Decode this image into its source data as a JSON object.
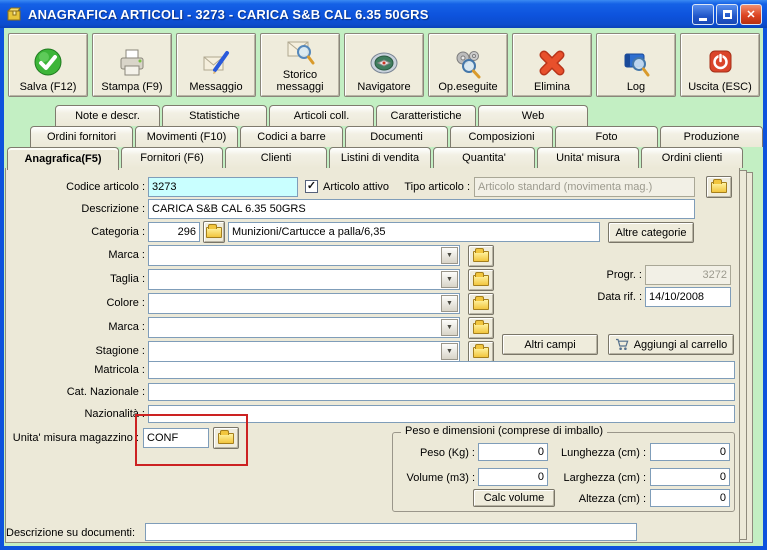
{
  "window": {
    "title": "ANAGRAFICA ARTICOLI - 3273 - CARICA S&B CAL 6.35 50GRS"
  },
  "toolbar": {
    "buttons": [
      {
        "label": "Salva (F12)",
        "icon": "save-check-icon"
      },
      {
        "label": "Stampa (F9)",
        "icon": "printer-icon"
      },
      {
        "label": "Messaggio",
        "icon": "message-pen-icon"
      },
      {
        "label": "Storico messaggi",
        "icon": "message-history-icon"
      },
      {
        "label": "Navigatore",
        "icon": "compass-icon"
      },
      {
        "label": "Op.eseguite",
        "icon": "gears-search-icon"
      },
      {
        "label": "Elimina",
        "icon": "red-x-icon"
      },
      {
        "label": "Log",
        "icon": "book-search-icon"
      },
      {
        "label": "Uscita (ESC)",
        "icon": "power-icon"
      }
    ]
  },
  "tabs": {
    "row1": [
      "Note e descr.",
      "Statistiche",
      "Articoli coll.",
      "Caratteristiche",
      "Web"
    ],
    "row2": [
      "Ordini fornitori",
      "Movimenti (F10)",
      "Codici a barre",
      "Documenti",
      "Composizioni",
      "Foto",
      "Produzione"
    ],
    "row3": [
      "Anagrafica(F5)",
      "Fornitori (F6)",
      "Clienti",
      "Listini di vendita",
      "Quantita'",
      "Unita' misura",
      "Ordini clienti"
    ],
    "active_tab": "Anagrafica(F5)"
  },
  "form": {
    "codice_articolo_label": "Codice articolo :",
    "codice_articolo_value": "3273",
    "articolo_attivo_label": "Articolo attivo",
    "articolo_attivo_checked": "✓",
    "tipo_articolo_label": "Tipo articolo :",
    "tipo_articolo_value": "Articolo standard (movimenta mag.)",
    "descrizione_label": "Descrizione :",
    "descrizione_value": "CARICA S&B CAL 6.35 50GRS",
    "categoria_label": "Categoria :",
    "categoria_code": "296",
    "categoria_value": "Munizioni/Cartucce a palla/6,35",
    "altre_categorie_button": "Altre categorie",
    "marca1_label": "Marca :",
    "taglia_label": "Taglia :",
    "colore_label": "Colore :",
    "marca2_label": "Marca :",
    "stagione_label": "Stagione :",
    "progr_label": "Progr. :",
    "progr_value": "3272",
    "data_rif_label": "Data rif. :",
    "data_rif_value": "14/10/2008",
    "altri_campi_button": "Altri campi",
    "aggiungi_carrello_button": "Aggiungi al carrello",
    "matricola_label": "Matricola :",
    "cat_nazionale_label": "Cat. Nazionale :",
    "nazionalita_label": "Nazionalità :",
    "unita_misura_label": "Unita' misura magazzino :",
    "unita_misura_value": "CONF",
    "descrizione_documenti_label": "Descrizione su documenti:",
    "descrizione_documenti_value": ""
  },
  "peso_group": {
    "title": "Peso e dimensioni (comprese di imballo)",
    "peso_label": "Peso (Kg) :",
    "peso_value": "0",
    "volume_label": "Volume (m3) :",
    "volume_value": "0",
    "calc_volume_button": "Calc volume",
    "lunghezza_label": "Lunghezza (cm) :",
    "lunghezza_value": "0",
    "larghezza_label": "Larghezza (cm) :",
    "larghezza_value": "0",
    "altezza_label": "Altezza (cm) :",
    "altezza_value": "0"
  },
  "annotation": {
    "type": "red-rectangle-highlight",
    "target": "unita-misura-magazzino-field"
  },
  "colors": {
    "titlebar_blue": "#0d53dd",
    "background_green": "#c3efc3",
    "panel_beige": "#ece9d8",
    "codice_input_cyan": "#c9ffff",
    "annotation_red": "#cc2222"
  }
}
